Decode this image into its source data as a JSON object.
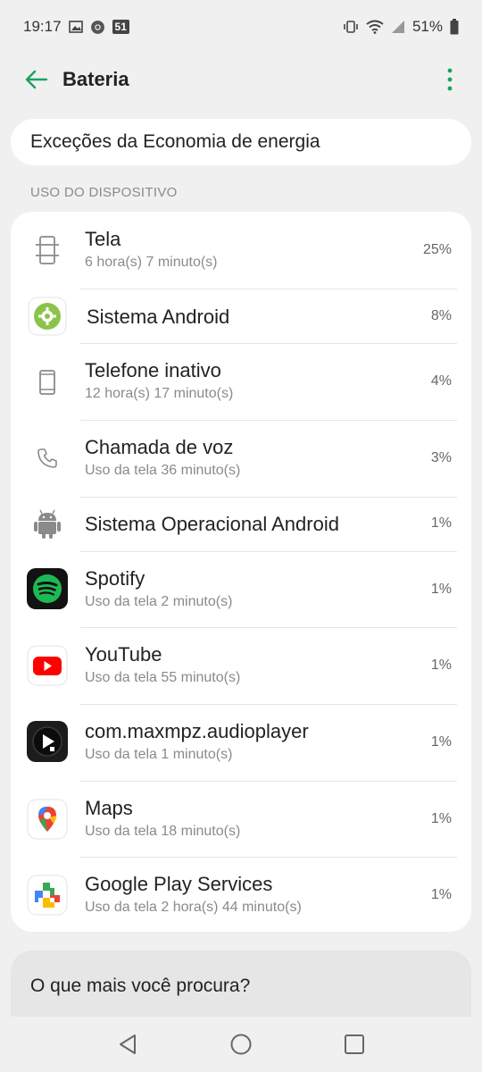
{
  "status_bar": {
    "time": "19:17",
    "badge": "51",
    "battery": "51%"
  },
  "header": {
    "title": "Bateria"
  },
  "exceptions_label": "Exceções da Economia de energia",
  "section_label": "USO DO DISPOSITIVO",
  "usage": [
    {
      "name": "Tela",
      "sub": "6 hora(s) 7 minuto(s)",
      "pct": "25%",
      "icon": "screen-icon"
    },
    {
      "name": "Sistema Android",
      "sub": "",
      "pct": "8%",
      "icon": "android-system-gear-icon"
    },
    {
      "name": "Telefone inativo",
      "sub": "12 hora(s) 17 minuto(s)",
      "pct": "4%",
      "icon": "phone-idle-icon"
    },
    {
      "name": "Chamada de voz",
      "sub": "Uso da tela 36 minuto(s)",
      "pct": "3%",
      "icon": "phone-call-icon"
    },
    {
      "name": "Sistema Operacional Android",
      "sub": "",
      "pct": "1%",
      "icon": "android-robot-icon"
    },
    {
      "name": "Spotify",
      "sub": "Uso da tela 2 minuto(s)",
      "pct": "1%",
      "icon": "spotify-icon"
    },
    {
      "name": "YouTube",
      "sub": "Uso da tela 55 minuto(s)",
      "pct": "1%",
      "icon": "youtube-icon"
    },
    {
      "name": "com.maxmpz.audioplayer",
      "sub": "Uso da tela 1 minuto(s)",
      "pct": "1%",
      "icon": "poweramp-icon"
    },
    {
      "name": "Maps",
      "sub": "Uso da tela 18 minuto(s)",
      "pct": "1%",
      "icon": "maps-icon"
    },
    {
      "name": "Google Play Services",
      "sub": "Uso da tela 2 hora(s) 44 minuto(s)",
      "pct": "1%",
      "icon": "play-services-icon"
    }
  ],
  "search_prompt": "O que mais você procura?",
  "colors": {
    "accent": "#1aa260",
    "background": "#f0f0f0",
    "card": "#ffffff"
  }
}
